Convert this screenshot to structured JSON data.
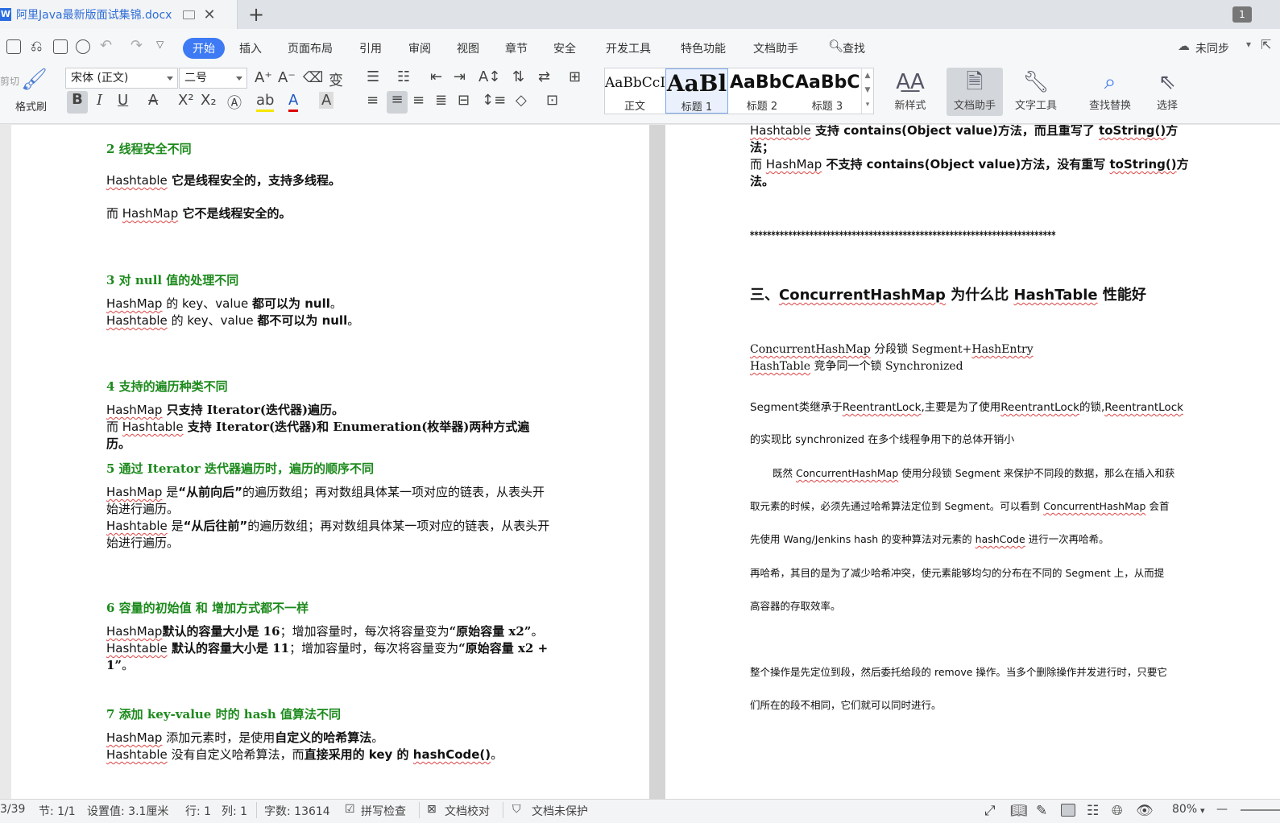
{
  "window": {
    "tab_title": "阿里Java最新版面试集锦.docx",
    "add_tab": "+",
    "window_count": "1"
  },
  "menu": {
    "items": [
      "开始",
      "插入",
      "页面布局",
      "引用",
      "审阅",
      "视图",
      "章节",
      "安全",
      "开发工具",
      "特色功能",
      "文档助手",
      "查找"
    ],
    "active": "开始",
    "sync_label": "未同步"
  },
  "ribbon": {
    "format_painter": "格式刷",
    "cut_label": "剪切",
    "font_name": "宋体 (正文)",
    "font_size": "二号",
    "styles": [
      {
        "sample": "AaBbCcDd",
        "name": "正文"
      },
      {
        "sample": "AaBl",
        "name": "标题 1"
      },
      {
        "sample": "AaBbC",
        "name": "标题 2"
      },
      {
        "sample": "AaBbC",
        "name": "标题 3"
      }
    ],
    "new_style": "新样式",
    "doc_assistant": "文档助手",
    "text_tools": "文字工具",
    "find_replace": "查找替换",
    "select": "选择"
  },
  "left_page": {
    "s2_title": "2  线程安全不同",
    "s2_p1_a": "Hashtable",
    "s2_p1_b": " 它是线程安全的，支持多线程。",
    "s2_p2_a": "而 ",
    "s2_p2_b": "HashMap",
    "s2_p2_c": " 它不是线程安全的。",
    "s3_title": "3  对 null 值的处理不同",
    "s3_l1_a": "HashMap",
    "s3_l1_b": " 的 key、value ",
    "s3_l1_c": "都可以为 null",
    "s3_l1_d": "。",
    "s3_l2_a": "Hashtable",
    "s3_l2_b": " 的 key、value ",
    "s3_l2_c": "都不可以为 null",
    "s3_l2_d": "。",
    "s4_title": "4  支持的遍历种类不同",
    "s4_l1_a": "HashMap",
    "s4_l1_b": " 只支持 Iterator(迭代器)遍历。",
    "s4_l2_a": "而 ",
    "s4_l2_b": "Hashtable",
    "s4_l2_c": " 支持 Iterator(迭代器)和 Enumeration(枚举器)两种方式遍历。",
    "s5_title": "5  通过 Iterator 迭代器遍历时，遍历的顺序不同",
    "s5_l1_a": "HashMap",
    "s5_l1_b": " 是",
    "s5_l1_c": "“从前向后”",
    "s5_l1_d": "的遍历数组；再对数组具体某一项对应的链表，从表头开始进行遍历。",
    "s5_l2_a": "Hashtable",
    "s5_l2_b": " 是",
    "s5_l2_c": "“从后往前”",
    "s5_l2_d": "的遍历数组；再对数组具体某一项对应的链表，从表头开始进行遍历。",
    "s6_title": "6  容量的初始值  和  增加方式都不一样",
    "s6_l1_a": "HashMap",
    "s6_l1_b": "默认的容量大小是 16",
    "s6_l1_c": "；增加容量时，每次将容量变为",
    "s6_l1_d": "“原始容量 x2”",
    "s6_l1_e": "。",
    "s6_l2_a": "Hashtable",
    "s6_l2_b": " 默认的容量大小是 11",
    "s6_l2_c": "；增加容量时，每次将容量变为",
    "s6_l2_d": "“原始容量 x2 + 1”",
    "s6_l2_e": "。",
    "s7_title": "7  添加 key-value 时的 hash 值算法不同",
    "s7_l1_a": "HashMap",
    "s7_l1_b": " 添加元素时，是使用",
    "s7_l1_c": "自定义的哈希算法",
    "s7_l1_d": "。",
    "s7_l2_a": "Hashtable",
    "s7_l2_b": " 没有自定义哈希算法，而",
    "s7_l2_c": "直接采用的 key 的 ",
    "s7_l2_d": "hashCode()",
    "s7_l2_e": "。"
  },
  "right_page": {
    "l1_a": "Hashtable",
    "l1_b": " 支持 contains(Object value)方法，而且重写了 ",
    "l1_c": "toString()",
    "l1_d": "方法；",
    "l2_a": "而 ",
    "l2_b": "HashMap",
    "l2_c": " 不支持 contains(Object value)方法，没有重写 ",
    "l2_d": "toString()",
    "l2_e": "方法。",
    "stars": "************************************************************************",
    "h3_a": "三、",
    "h3_b": "ConcurrentHashMap",
    "h3_c": " 为什么比 ",
    "h3_d": "HashTable",
    "h3_e": " 性能好",
    "c1_a": "ConcurrentHashMap",
    "c1_b": "  分段锁  Segment+",
    "c1_c": "HashEntry",
    "c2_a": "HashTable",
    "c2_b": " 竞争同一个锁  Synchronized",
    "seg1_a": "Segment类继承于",
    "seg1_b": "ReentrantLock",
    "seg1_c": ",主要是为了使用",
    "seg1_d": "ReentrantLock",
    "seg1_e": "的锁,",
    "seg1_f": "ReentrantLock",
    "seg2": "的实现比  synchronized 在多个线程争用下的总体开销小",
    "p1_a": "既然 ",
    "p1_b": "ConcurrentHashMap",
    "p1_c": " 使用分段锁 Segment 来保护不同段的数据，那么在插入和获",
    "p2_a": "取元素的时候，必须先通过哈希算法定位到 Segment。可以看到 ",
    "p2_b": "ConcurrentHashMap",
    "p2_c": " 会首",
    "p3_a": "先使用 Wang/Jenkins hash 的变种算法对元素的 ",
    "p3_b": "hashCode",
    "p3_c": " 进行一次再哈希。",
    "p4": "再哈希，其目的是为了减少哈希冲突，使元素能够均匀的分布在不同的 Segment 上，从而提",
    "p5": "高容器的存取效率。",
    "p6": "整个操作是先定位到段，然后委托给段的 remove 操作。当多个删除操作并发进行时，只要它",
    "p7": "们所在的段不相同，它们就可以同时进行。"
  },
  "status": {
    "page": "3/39",
    "section": "节: 1/1",
    "setting": "设置值: 3.1厘米",
    "row": "行: 1",
    "col": "列: 1",
    "word_count": "字数: 13614",
    "spell_check": "拼写检查",
    "proofread": "文档校对",
    "protect": "文档未保护",
    "zoom": "80%",
    "zoom_minus": "—"
  }
}
